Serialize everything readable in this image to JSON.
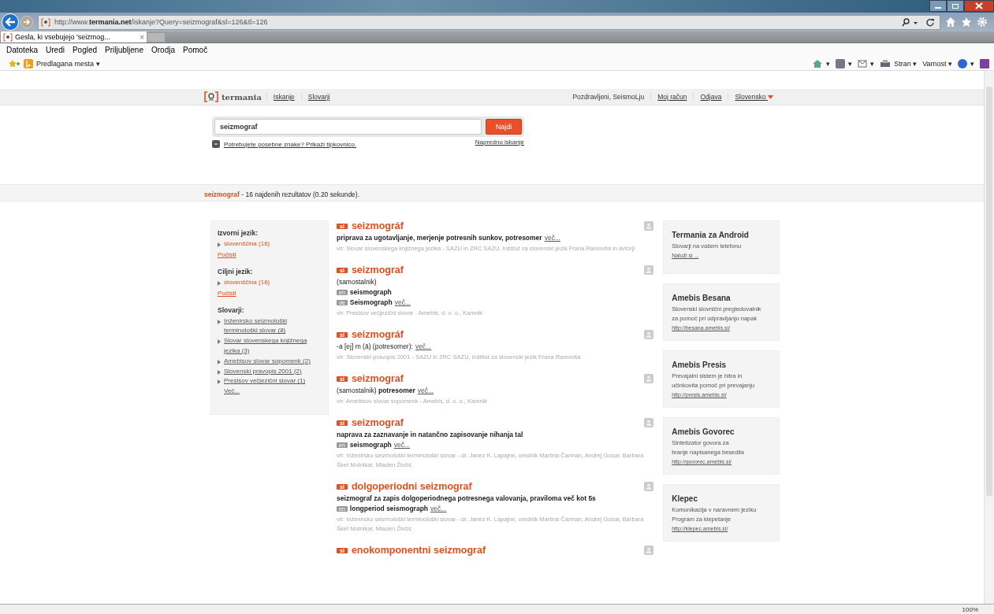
{
  "browser": {
    "url_prefix": "http://www.",
    "url_domain": "termania.net",
    "url_path": "/iskanje?Query=seizmograf&sl=126&tl=126",
    "tab": {
      "label": "Gesla, ki vsebujejo 'seizmog...",
      "close": "×",
      "selected": true
    },
    "menu": [
      "Datoteka",
      "Uredi",
      "Pogled",
      "Priljubljene",
      "Orodja",
      "Pomoč"
    ],
    "favorites": "Predlagana mesta ▾",
    "tools": [
      "▾",
      "▾",
      "▾",
      "Stran ▾",
      "Varnost ▾",
      "▾"
    ],
    "zoom": "100%"
  },
  "header": {
    "logo": "termania",
    "nav": [
      "Iskanje",
      "Slovarji"
    ],
    "greeting": "Pozdravljeni, SeismoLju",
    "links": [
      "Moj račun",
      "Odjava"
    ],
    "language": "Slovensko"
  },
  "search": {
    "value": "seizmograf",
    "button": "Najdi",
    "keyboard_link": "Potrebujete posebne znake? Prikaži tipkovnico.",
    "advanced_link": "Napredno iskanje"
  },
  "summary": {
    "query": "seizmograf",
    "text": " - 16 najdenih rezultatov (0.20 sekunde)."
  },
  "sidebar": [
    {
      "title": "Izvorni jezik:",
      "items": [
        {
          "kind": "language",
          "text": "slovenščina (16)"
        }
      ],
      "clear": "Počisti"
    },
    {
      "title": "Ciljni jezik:",
      "items": [
        {
          "kind": "language",
          "text": "slovenščina (16)"
        }
      ],
      "clear": "Počisti"
    },
    {
      "title": "Slovarji:",
      "items": [
        {
          "kind": "dictionary",
          "text": "Inženirsko seizmološki terminološki slovar (8)"
        },
        {
          "kind": "dictionary",
          "text": "Slovar slovenskega knjižnega jezika (3)"
        },
        {
          "kind": "dictionary",
          "text": "Amebisov slovar sopomenk (2)"
        },
        {
          "kind": "dictionary",
          "text": "Slovenski pravopis 2001 (2)"
        },
        {
          "kind": "dictionary",
          "text": "Presisov večjezični slovar (1)"
        },
        {
          "kind": "more",
          "text": "Več..."
        }
      ]
    }
  ],
  "results": [
    {
      "lang": "sl",
      "title": "seizmográf",
      "lines": [
        {
          "text": "priprava za ugotavljanje, merjenje potresnih sunkov, potresomer",
          "bold": true,
          "more": "več..."
        }
      ],
      "source": "vir: Slovar slovenskega knjižnega jezika - SAZU in ZRC SAZU, Inštitut za slovenski jezik Frana Ramovša in avtorji"
    },
    {
      "lang": "sl",
      "title": "seizmograf",
      "lines": [
        {
          "text": "(samostalnik)",
          "bold": false
        },
        {
          "tag": "en",
          "text": "seismograph",
          "bold": true
        },
        {
          "tag": "de",
          "text": "Seismograph",
          "bold": true,
          "more": "več..."
        }
      ],
      "source": "vir: Presisov večjezični slovar - Amebis, d. o. o., Kamnik"
    },
    {
      "lang": "sl",
      "title": "seizmográf",
      "lines": [
        {
          "text": "-a [ej] m (ā) (potresomer):",
          "bold": false,
          "more": "več..."
        }
      ],
      "source": "vir: Slovenski pravopis 2001 - SAZU in ZRC SAZU, Inštitut za slovenski jezik Frana Ramovša"
    },
    {
      "lang": "sl",
      "title": "seizmograf",
      "lines": [
        {
          "text": "(samostalnik) **potresomer**",
          "bold": false,
          "more": "več..."
        }
      ],
      "source": "vir: Amebisov slovar sopomenk - Amebis, d. o. o., Kamnik"
    },
    {
      "lang": "sl",
      "title": "seizmograf",
      "lines": [
        {
          "text": "naprava za zaznavanje in natančno zapisovanje nihanja tal",
          "bold": true
        },
        {
          "tag": "en",
          "text": "seismograph",
          "bold": true,
          "more": "več..."
        }
      ],
      "source": "vir: Inženirsko seizmološki terminološki slovar - dr. Janez K. Lapajne, urednik Martina Čarman, Andrej Gosar, Barbara Šket Motnikar, Mladen Živčić"
    },
    {
      "lang": "sl",
      "title": "dolgoperiodni seizmograf",
      "lines": [
        {
          "text": "seizmograf za zapis dolgoperiodnega potresnega valovanja, praviloma več kot 5s",
          "bold": true
        },
        {
          "tag": "en",
          "text": "longperiod seismograph",
          "bold": true,
          "more": "več..."
        }
      ],
      "source": "vir: Inženirsko seizmološki terminološki slovar - dr. Janez K. Lapajne, urednik Martina Čarman, Andrej Gosar, Barbara Šket Motnikar, Mladen Živčić"
    },
    {
      "lang": "sl",
      "title": "enokomponentni seizmograf"
    }
  ],
  "ads": [
    {
      "title": "Termania za Android",
      "text": [
        "Slovarji na vašem telefonu"
      ],
      "link": "Naloži si ..."
    },
    {
      "title": "Amebis Besana",
      "text": [
        "Slovenski slovnični pregledovalnik",
        "za pomoč pri odpravljanju napak"
      ],
      "link": "http://besana.amebis.si/"
    },
    {
      "title": "Amebis Presis",
      "text": [
        "Prevajalni sistem je hitra in",
        "učinkovita pomoč pri prevajanju"
      ],
      "link": "http://presis.amebis.si/"
    },
    {
      "title": "Amebis Govorec",
      "text": [
        "Sintetizator govora za",
        "branje napisanega besedila"
      ],
      "link": "http://govorec.amebis.si/"
    },
    {
      "title": "Klepec",
      "text": [
        "Komunikacija v naravnem jeziku",
        "Program za klepetanje"
      ],
      "link": "http://klepec.amebis.si/"
    }
  ]
}
